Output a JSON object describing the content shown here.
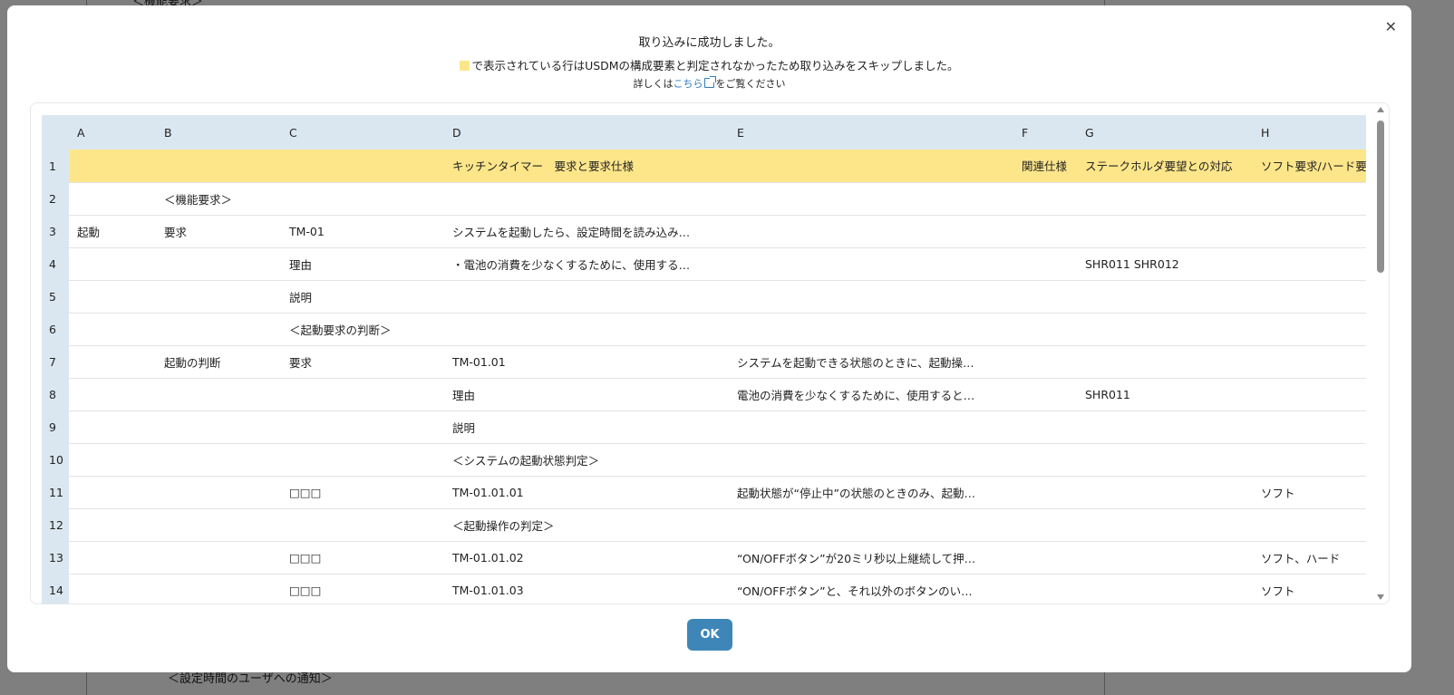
{
  "background": {
    "top_text": "＜機能要求＞",
    "bottom_text": "＜設定時間のユーザへの通知＞"
  },
  "dialog": {
    "close_icon": "close-icon",
    "title": "取り込みに成功しました。",
    "skip_message": "で表示されている行はUSDMの構成要素と判定されなかったため取り込みをスキップしました。",
    "skip_color": "#fde68a",
    "detail_prefix": "詳しくは",
    "detail_link": "こちら",
    "detail_suffix": "をご覧ください",
    "ok_label": "OK"
  },
  "table": {
    "columns": [
      "A",
      "B",
      "C",
      "D",
      "E",
      "F",
      "G",
      "H"
    ],
    "rows": [
      {
        "n": "1",
        "skip": true,
        "cells": [
          "",
          "",
          "",
          "キッチンタイマー　要求と要求仕様",
          "",
          "関連仕様",
          "ステークホルダ要望との対応",
          "ソフト要求/ハード要求"
        ]
      },
      {
        "n": "2",
        "cells": [
          "",
          "＜機能要求＞",
          "",
          "",
          "",
          "",
          "",
          ""
        ]
      },
      {
        "n": "3",
        "cells": [
          "起動",
          "要求",
          "TM-01",
          "システムを起動したら、設定時間を読み込み…",
          "",
          "",
          "",
          ""
        ]
      },
      {
        "n": "4",
        "cells": [
          "",
          "",
          "理由",
          "・電池の消費を少なくするために、使用する…",
          "",
          "",
          "SHR011 SHR012",
          ""
        ]
      },
      {
        "n": "5",
        "cells": [
          "",
          "",
          "説明",
          "",
          "",
          "",
          "",
          ""
        ]
      },
      {
        "n": "6",
        "cells": [
          "",
          "",
          "＜起動要求の判断＞",
          "",
          "",
          "",
          "",
          ""
        ]
      },
      {
        "n": "7",
        "cells": [
          "",
          "起動の判断",
          "要求",
          "TM-01.01",
          "システムを起動できる状態のときに、起動操…",
          "",
          "",
          ""
        ]
      },
      {
        "n": "8",
        "cells": [
          "",
          "",
          "",
          "理由",
          "電池の消費を少なくするために、使用すると…",
          "",
          "SHR011",
          ""
        ]
      },
      {
        "n": "9",
        "cells": [
          "",
          "",
          "",
          "説明",
          "",
          "",
          "",
          ""
        ]
      },
      {
        "n": "10",
        "cells": [
          "",
          "",
          "",
          "＜システムの起動状態判定＞",
          "",
          "",
          "",
          ""
        ]
      },
      {
        "n": "11",
        "cells": [
          "",
          "",
          "□□□",
          "TM-01.01.01",
          "起動状態が“停止中”の状態のときのみ、起動…",
          "",
          "",
          "ソフト"
        ]
      },
      {
        "n": "12",
        "cells": [
          "",
          "",
          "",
          "＜起動操作の判定＞",
          "",
          "",
          "",
          ""
        ]
      },
      {
        "n": "13",
        "cells": [
          "",
          "",
          "□□□",
          "TM-01.01.02",
          "“ON/OFFボタン”が20ミリ秒以上継続して押…",
          "",
          "",
          "ソフト、ハード"
        ]
      },
      {
        "n": "14",
        "cells": [
          "",
          "",
          "□□□",
          "TM-01.01.03",
          "“ON/OFFボタン”と、それ以外のボタンのい…",
          "",
          "",
          "ソフト"
        ]
      }
    ]
  }
}
